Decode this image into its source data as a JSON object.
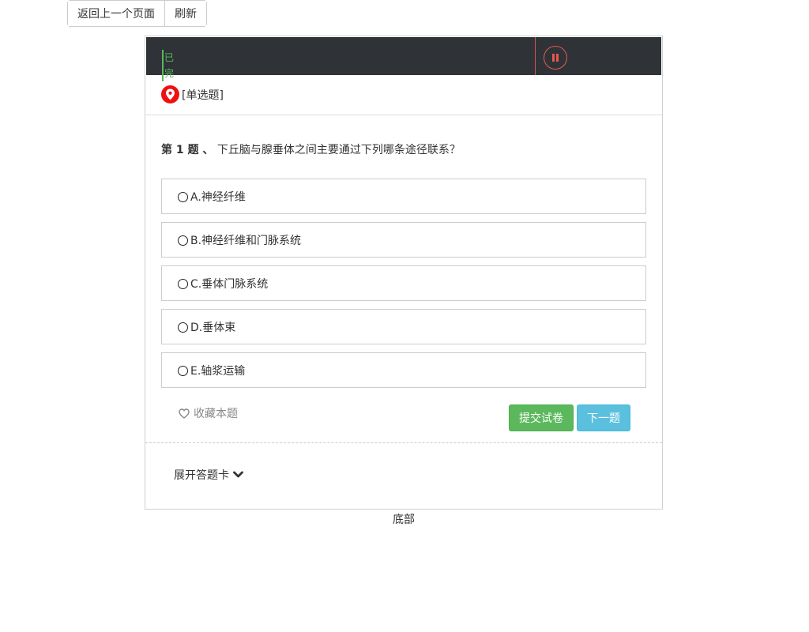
{
  "toolbar": {
    "back_label": "返回上一个页面",
    "refresh_label": "刷新"
  },
  "timer": {
    "progress_label": "已完",
    "pause_icon": "pause-icon"
  },
  "question": {
    "type_label": "[单选题]",
    "number_label": "第 1 题",
    "separator": " 、",
    "text": "下丘脑与腺垂体之间主要通过下列哪条途径联系？",
    "options": [
      {
        "label": "A.神经纤维"
      },
      {
        "label": "B.神经纤维和门脉系统"
      },
      {
        "label": "C.垂体门脉系统"
      },
      {
        "label": "D.垂体束"
      },
      {
        "label": "E.轴浆运输"
      }
    ]
  },
  "actions": {
    "favorite_label": "收藏本题",
    "submit_label": "提交试卷",
    "next_label": "下一题"
  },
  "answer_card": {
    "toggle_label": "展开答题卡"
  },
  "footer": {
    "text": "底部"
  },
  "colors": {
    "timer_bg": "#2f3338",
    "progress": "#5cb85c",
    "pause": "#e8584f",
    "pin": "#ee1111",
    "submit": "#5cb85c",
    "next": "#5bc0de"
  }
}
